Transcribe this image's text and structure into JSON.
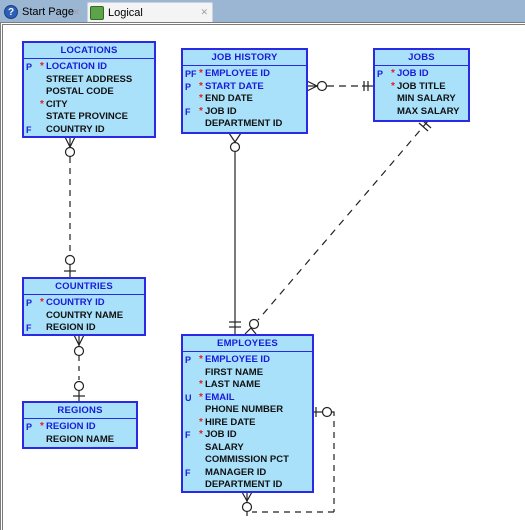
{
  "tabs": [
    {
      "label": "Start Page",
      "icon": "help-icon",
      "active": false
    },
    {
      "label": "Logical",
      "icon": "logical-model-icon",
      "active": true
    }
  ],
  "colors": {
    "entity_fill": "#a9e1fb",
    "entity_border": "#2a2ae6",
    "key_text": "#1a1ad9",
    "required_marker": "#e02020",
    "tabbar": "#9bb6d2"
  },
  "entities": {
    "locations": {
      "title": "LOCATIONS",
      "attributes": [
        {
          "key": "P",
          "required": true,
          "name": "LOCATION ID",
          "highlight": true
        },
        {
          "key": "",
          "required": false,
          "name": "STREET ADDRESS",
          "highlight": false
        },
        {
          "key": "",
          "required": false,
          "name": "POSTAL CODE",
          "highlight": false
        },
        {
          "key": "",
          "required": true,
          "name": "CITY",
          "highlight": false
        },
        {
          "key": "",
          "required": false,
          "name": "STATE PROVINCE",
          "highlight": false
        },
        {
          "key": "F",
          "required": false,
          "name": "COUNTRY ID",
          "highlight": false
        }
      ]
    },
    "job_history": {
      "title": "JOB HISTORY",
      "attributes": [
        {
          "key": "PF",
          "required": true,
          "name": "EMPLOYEE ID",
          "highlight": true
        },
        {
          "key": "P",
          "required": true,
          "name": "START DATE",
          "highlight": true
        },
        {
          "key": "",
          "required": true,
          "name": "END DATE",
          "highlight": false
        },
        {
          "key": "F",
          "required": true,
          "name": "JOB ID",
          "highlight": false
        },
        {
          "key": "",
          "required": false,
          "name": "DEPARTMENT ID",
          "highlight": false
        }
      ]
    },
    "jobs": {
      "title": "JOBS",
      "attributes": [
        {
          "key": "P",
          "required": true,
          "name": "JOB ID",
          "highlight": true
        },
        {
          "key": "",
          "required": true,
          "name": "JOB TITLE",
          "highlight": false
        },
        {
          "key": "",
          "required": false,
          "name": "MIN SALARY",
          "highlight": false
        },
        {
          "key": "",
          "required": false,
          "name": "MAX SALARY",
          "highlight": false
        }
      ]
    },
    "countries": {
      "title": "COUNTRIES",
      "attributes": [
        {
          "key": "P",
          "required": true,
          "name": "COUNTRY ID",
          "highlight": true
        },
        {
          "key": "",
          "required": false,
          "name": "COUNTRY NAME",
          "highlight": false
        },
        {
          "key": "F",
          "required": false,
          "name": "REGION ID",
          "highlight": false
        }
      ]
    },
    "regions": {
      "title": "REGIONS",
      "attributes": [
        {
          "key": "P",
          "required": true,
          "name": "REGION ID",
          "highlight": true
        },
        {
          "key": "",
          "required": false,
          "name": "REGION NAME",
          "highlight": false
        }
      ]
    },
    "employees": {
      "title": "EMPLOYEES",
      "attributes": [
        {
          "key": "P",
          "required": true,
          "name": "EMPLOYEE ID",
          "highlight": true
        },
        {
          "key": "",
          "required": false,
          "name": "FIRST NAME",
          "highlight": false
        },
        {
          "key": "",
          "required": true,
          "name": "LAST NAME",
          "highlight": false
        },
        {
          "key": "U",
          "required": true,
          "name": "EMAIL",
          "highlight": true
        },
        {
          "key": "",
          "required": false,
          "name": "PHONE NUMBER",
          "highlight": false
        },
        {
          "key": "",
          "required": true,
          "name": "HIRE DATE",
          "highlight": false
        },
        {
          "key": "F",
          "required": true,
          "name": "JOB ID",
          "highlight": false
        },
        {
          "key": "",
          "required": false,
          "name": "SALARY",
          "highlight": false
        },
        {
          "key": "",
          "required": false,
          "name": "COMMISSION PCT",
          "highlight": false
        },
        {
          "key": "F",
          "required": false,
          "name": "MANAGER ID",
          "highlight": false
        },
        {
          "key": "",
          "required": false,
          "name": "DEPARTMENT ID",
          "highlight": false
        }
      ]
    }
  },
  "relationships": [
    {
      "from": "locations",
      "to": "countries",
      "from_end": "zero-or-many",
      "to_end": "zero-or-one",
      "line": "dashed"
    },
    {
      "from": "countries",
      "to": "regions",
      "from_end": "zero-or-many",
      "to_end": "zero-or-one",
      "line": "dashed"
    },
    {
      "from": "job_history",
      "to": "jobs",
      "from_end": "zero-or-many",
      "to_end": "exactly-one",
      "line": "dashed"
    },
    {
      "from": "job_history",
      "to": "employees",
      "from_end": "zero-or-many",
      "to_end": "exactly-one",
      "line": "solid"
    },
    {
      "from": "jobs",
      "to": "employees",
      "from_end": "exactly-one",
      "to_end": "zero-or-many",
      "line": "dashed"
    },
    {
      "from": "employees",
      "to": "employees",
      "from_end": "zero-or-many",
      "to_end": "zero-or-one",
      "line": "dashed"
    }
  ]
}
